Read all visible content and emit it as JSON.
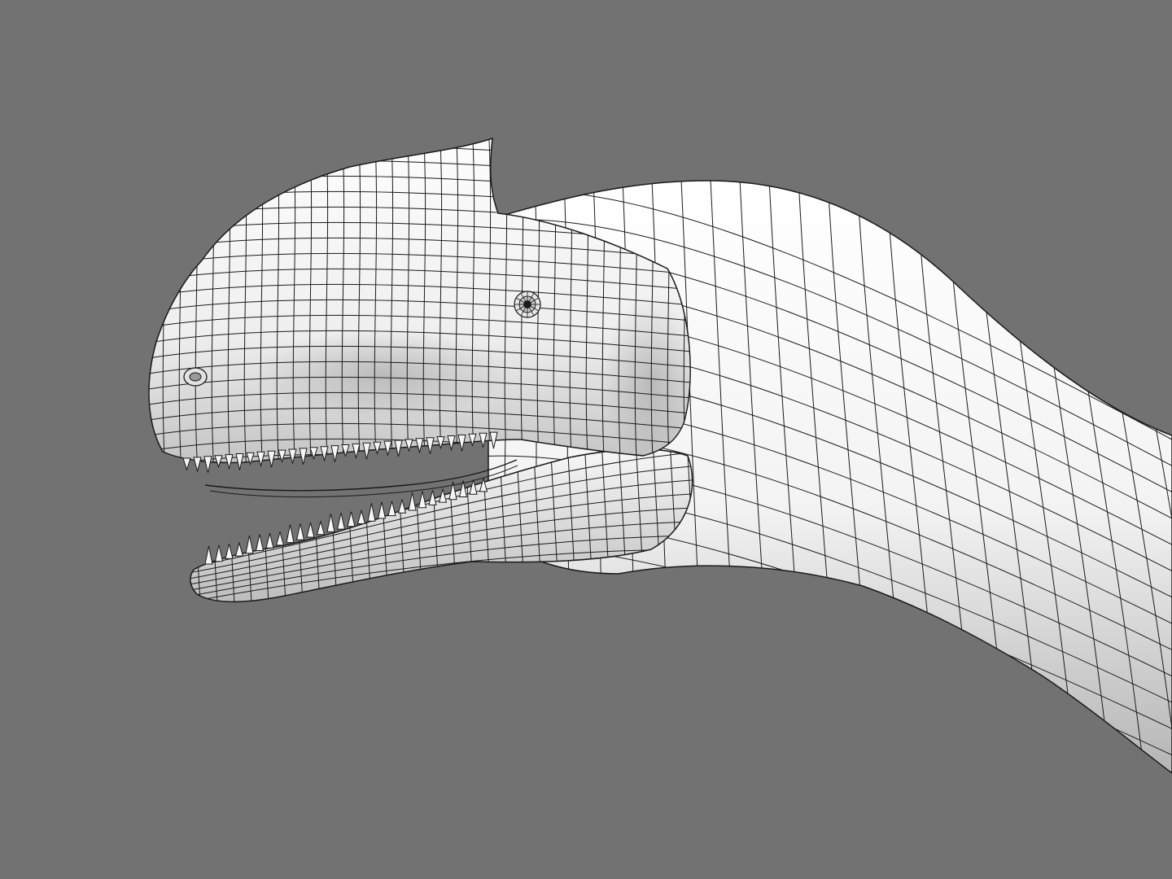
{
  "viewport": {
    "background_color": "#727272",
    "subject": "dinosaur-head-wireframe-render",
    "mesh_fill_color": "#f2f2f2",
    "shade_color": "#b9b9b9",
    "wire_color": "#1a1a1a",
    "tooth_fill_color": "#f6f6f6"
  }
}
